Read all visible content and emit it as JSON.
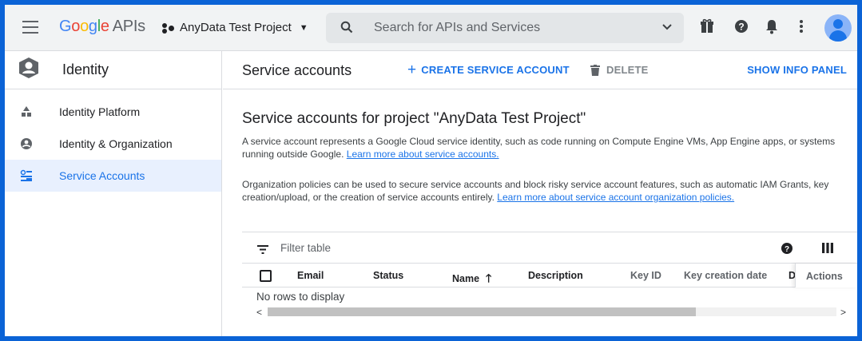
{
  "header": {
    "logo_letters": [
      "G",
      "o",
      "o",
      "g",
      "l",
      "e"
    ],
    "logo_suffix": "APIs",
    "project_name": "AnyData Test Project",
    "search_placeholder": "Search for APIs and Services",
    "icons": [
      "menu-icon",
      "gift-icon",
      "help-icon",
      "bell-icon",
      "more-vert-icon",
      "account-avatar"
    ]
  },
  "sidebar": {
    "title": "Identity",
    "items": [
      {
        "label": "Identity Platform",
        "icon": "identity-platform-icon",
        "active": false
      },
      {
        "label": "Identity & Organization",
        "icon": "account-circle-icon",
        "active": false
      },
      {
        "label": "Service Accounts",
        "icon": "service-accounts-icon",
        "active": true
      }
    ]
  },
  "toolbar": {
    "page_title": "Service accounts",
    "create_label": "CREATE SERVICE ACCOUNT",
    "delete_label": "DELETE",
    "info_label": "SHOW INFO PANEL"
  },
  "content": {
    "heading": "Service accounts for project \"AnyData Test Project\"",
    "para1_text": "A service account represents a Google Cloud service identity, such as code running on Compute Engine VMs, App Engine apps, or systems running outside Google. ",
    "para1_link": "Learn more about service accounts.",
    "para2_text": "Organization policies can be used to secure service accounts and block risky service account features, such as automatic IAM Grants, key creation/upload, or the creation of service accounts entirely. ",
    "para2_link": "Learn more about service account organization policies."
  },
  "table": {
    "filter_placeholder": "Filter table",
    "columns": [
      "Email",
      "Status",
      "Name",
      "Description",
      "Key ID",
      "Key creation date",
      "D",
      "Actions"
    ],
    "sorted_column": "Name",
    "sort_direction": "ascending",
    "empty_message": "No rows to display"
  },
  "colors": {
    "accent": "#1a73e8",
    "frame": "#0b63d6",
    "active_bg": "#e8f0fe",
    "topbar_bg": "#f1f3f4"
  }
}
